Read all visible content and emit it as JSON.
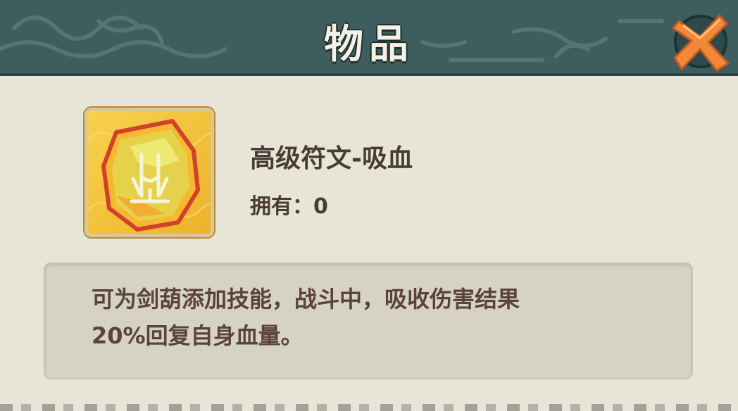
{
  "header": {
    "title": "物品",
    "close_icon": "close-x-icon"
  },
  "item": {
    "icon": "rune-lifesteal-icon",
    "name": "高级符文-吸血",
    "own_label": "拥有：",
    "own_count": "0"
  },
  "description": {
    "line1": "可为剑葫添加技能，战斗中，吸收伤害结果",
    "line2": "20%回复自身血量。"
  },
  "colors": {
    "header_bg": "#3e5d5e",
    "panel_bg": "#e6e5d8",
    "text": "#4a3b33",
    "close_accent": "#f08a3a"
  }
}
